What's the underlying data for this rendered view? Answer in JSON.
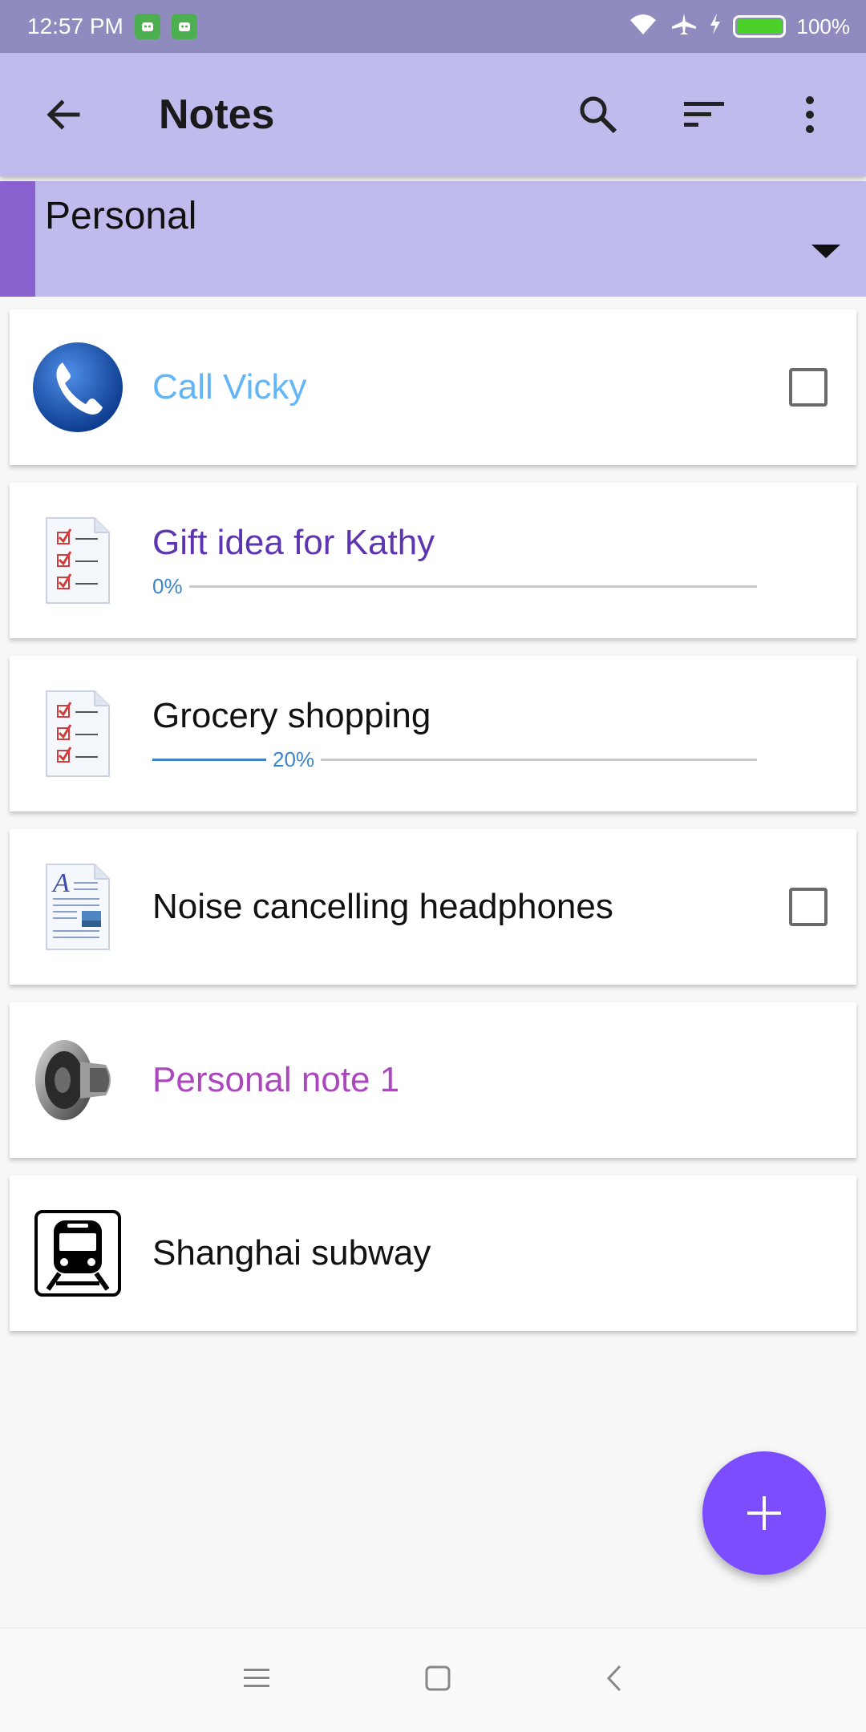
{
  "status_bar": {
    "time": "12:57 PM",
    "battery": "100%",
    "icons": [
      "app-notification-icon",
      "app-notification-icon",
      "wifi-icon",
      "airplane-icon",
      "charging-icon",
      "battery-icon"
    ]
  },
  "app_bar": {
    "title": "Notes",
    "actions": [
      "back-icon",
      "search-icon",
      "sort-icon",
      "more-vert-icon"
    ]
  },
  "folder": {
    "label": "Personal",
    "accent_color": "#8a62cf"
  },
  "notes": [
    {
      "title": "Call Vicky",
      "color": "#64b5f6",
      "icon": "phone-icon",
      "checkbox": true
    },
    {
      "title": "Gift idea for Kathy",
      "color": "#5e35b1",
      "icon": "checklist-icon",
      "progress": 0,
      "progress_label": "0%"
    },
    {
      "title": "Grocery shopping",
      "color": "#111111",
      "icon": "checklist-icon",
      "progress": 20,
      "progress_label": "20%"
    },
    {
      "title": "Noise cancelling headphones",
      "color": "#111111",
      "icon": "document-icon",
      "checkbox": true
    },
    {
      "title": "Personal note 1",
      "color": "#ab47bc",
      "icon": "speaker-icon"
    },
    {
      "title": "Shanghai subway",
      "color": "#111111",
      "icon": "train-icon"
    }
  ],
  "fab": {
    "icon": "plus-icon",
    "color": "#7c4dff"
  },
  "nav_bar": {
    "icons": [
      "menu-icon",
      "home-icon",
      "back-nav-icon"
    ]
  }
}
